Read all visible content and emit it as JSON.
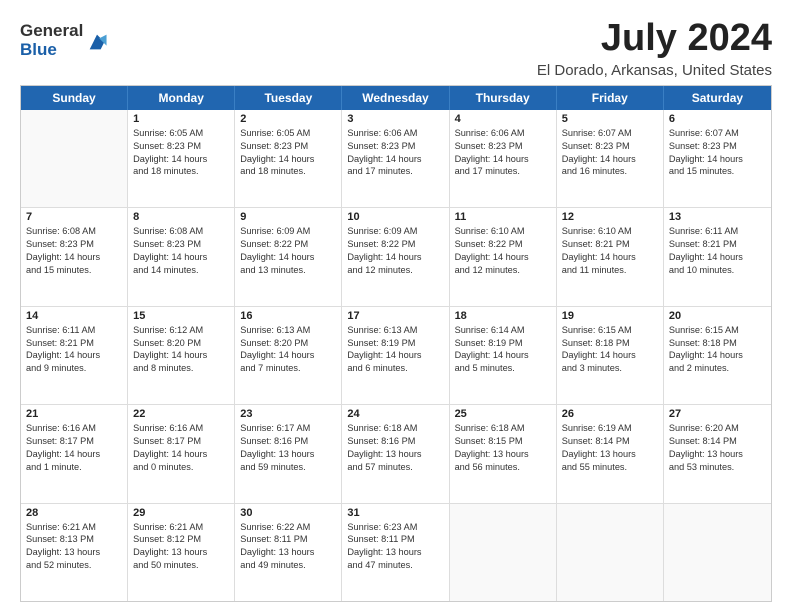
{
  "logo": {
    "general": "General",
    "blue": "Blue"
  },
  "title": "July 2024",
  "location": "El Dorado, Arkansas, United States",
  "days_of_week": [
    "Sunday",
    "Monday",
    "Tuesday",
    "Wednesday",
    "Thursday",
    "Friday",
    "Saturday"
  ],
  "rows": [
    [
      {
        "day": "",
        "lines": []
      },
      {
        "day": "1",
        "lines": [
          "Sunrise: 6:05 AM",
          "Sunset: 8:23 PM",
          "Daylight: 14 hours",
          "and 18 minutes."
        ]
      },
      {
        "day": "2",
        "lines": [
          "Sunrise: 6:05 AM",
          "Sunset: 8:23 PM",
          "Daylight: 14 hours",
          "and 18 minutes."
        ]
      },
      {
        "day": "3",
        "lines": [
          "Sunrise: 6:06 AM",
          "Sunset: 8:23 PM",
          "Daylight: 14 hours",
          "and 17 minutes."
        ]
      },
      {
        "day": "4",
        "lines": [
          "Sunrise: 6:06 AM",
          "Sunset: 8:23 PM",
          "Daylight: 14 hours",
          "and 17 minutes."
        ]
      },
      {
        "day": "5",
        "lines": [
          "Sunrise: 6:07 AM",
          "Sunset: 8:23 PM",
          "Daylight: 14 hours",
          "and 16 minutes."
        ]
      },
      {
        "day": "6",
        "lines": [
          "Sunrise: 6:07 AM",
          "Sunset: 8:23 PM",
          "Daylight: 14 hours",
          "and 15 minutes."
        ]
      }
    ],
    [
      {
        "day": "7",
        "lines": [
          "Sunrise: 6:08 AM",
          "Sunset: 8:23 PM",
          "Daylight: 14 hours",
          "and 15 minutes."
        ]
      },
      {
        "day": "8",
        "lines": [
          "Sunrise: 6:08 AM",
          "Sunset: 8:23 PM",
          "Daylight: 14 hours",
          "and 14 minutes."
        ]
      },
      {
        "day": "9",
        "lines": [
          "Sunrise: 6:09 AM",
          "Sunset: 8:22 PM",
          "Daylight: 14 hours",
          "and 13 minutes."
        ]
      },
      {
        "day": "10",
        "lines": [
          "Sunrise: 6:09 AM",
          "Sunset: 8:22 PM",
          "Daylight: 14 hours",
          "and 12 minutes."
        ]
      },
      {
        "day": "11",
        "lines": [
          "Sunrise: 6:10 AM",
          "Sunset: 8:22 PM",
          "Daylight: 14 hours",
          "and 12 minutes."
        ]
      },
      {
        "day": "12",
        "lines": [
          "Sunrise: 6:10 AM",
          "Sunset: 8:21 PM",
          "Daylight: 14 hours",
          "and 11 minutes."
        ]
      },
      {
        "day": "13",
        "lines": [
          "Sunrise: 6:11 AM",
          "Sunset: 8:21 PM",
          "Daylight: 14 hours",
          "and 10 minutes."
        ]
      }
    ],
    [
      {
        "day": "14",
        "lines": [
          "Sunrise: 6:11 AM",
          "Sunset: 8:21 PM",
          "Daylight: 14 hours",
          "and 9 minutes."
        ]
      },
      {
        "day": "15",
        "lines": [
          "Sunrise: 6:12 AM",
          "Sunset: 8:20 PM",
          "Daylight: 14 hours",
          "and 8 minutes."
        ]
      },
      {
        "day": "16",
        "lines": [
          "Sunrise: 6:13 AM",
          "Sunset: 8:20 PM",
          "Daylight: 14 hours",
          "and 7 minutes."
        ]
      },
      {
        "day": "17",
        "lines": [
          "Sunrise: 6:13 AM",
          "Sunset: 8:19 PM",
          "Daylight: 14 hours",
          "and 6 minutes."
        ]
      },
      {
        "day": "18",
        "lines": [
          "Sunrise: 6:14 AM",
          "Sunset: 8:19 PM",
          "Daylight: 14 hours",
          "and 5 minutes."
        ]
      },
      {
        "day": "19",
        "lines": [
          "Sunrise: 6:15 AM",
          "Sunset: 8:18 PM",
          "Daylight: 14 hours",
          "and 3 minutes."
        ]
      },
      {
        "day": "20",
        "lines": [
          "Sunrise: 6:15 AM",
          "Sunset: 8:18 PM",
          "Daylight: 14 hours",
          "and 2 minutes."
        ]
      }
    ],
    [
      {
        "day": "21",
        "lines": [
          "Sunrise: 6:16 AM",
          "Sunset: 8:17 PM",
          "Daylight: 14 hours",
          "and 1 minute."
        ]
      },
      {
        "day": "22",
        "lines": [
          "Sunrise: 6:16 AM",
          "Sunset: 8:17 PM",
          "Daylight: 14 hours",
          "and 0 minutes."
        ]
      },
      {
        "day": "23",
        "lines": [
          "Sunrise: 6:17 AM",
          "Sunset: 8:16 PM",
          "Daylight: 13 hours",
          "and 59 minutes."
        ]
      },
      {
        "day": "24",
        "lines": [
          "Sunrise: 6:18 AM",
          "Sunset: 8:16 PM",
          "Daylight: 13 hours",
          "and 57 minutes."
        ]
      },
      {
        "day": "25",
        "lines": [
          "Sunrise: 6:18 AM",
          "Sunset: 8:15 PM",
          "Daylight: 13 hours",
          "and 56 minutes."
        ]
      },
      {
        "day": "26",
        "lines": [
          "Sunrise: 6:19 AM",
          "Sunset: 8:14 PM",
          "Daylight: 13 hours",
          "and 55 minutes."
        ]
      },
      {
        "day": "27",
        "lines": [
          "Sunrise: 6:20 AM",
          "Sunset: 8:14 PM",
          "Daylight: 13 hours",
          "and 53 minutes."
        ]
      }
    ],
    [
      {
        "day": "28",
        "lines": [
          "Sunrise: 6:21 AM",
          "Sunset: 8:13 PM",
          "Daylight: 13 hours",
          "and 52 minutes."
        ]
      },
      {
        "day": "29",
        "lines": [
          "Sunrise: 6:21 AM",
          "Sunset: 8:12 PM",
          "Daylight: 13 hours",
          "and 50 minutes."
        ]
      },
      {
        "day": "30",
        "lines": [
          "Sunrise: 6:22 AM",
          "Sunset: 8:11 PM",
          "Daylight: 13 hours",
          "and 49 minutes."
        ]
      },
      {
        "day": "31",
        "lines": [
          "Sunrise: 6:23 AM",
          "Sunset: 8:11 PM",
          "Daylight: 13 hours",
          "and 47 minutes."
        ]
      },
      {
        "day": "",
        "lines": []
      },
      {
        "day": "",
        "lines": []
      },
      {
        "day": "",
        "lines": []
      }
    ]
  ]
}
